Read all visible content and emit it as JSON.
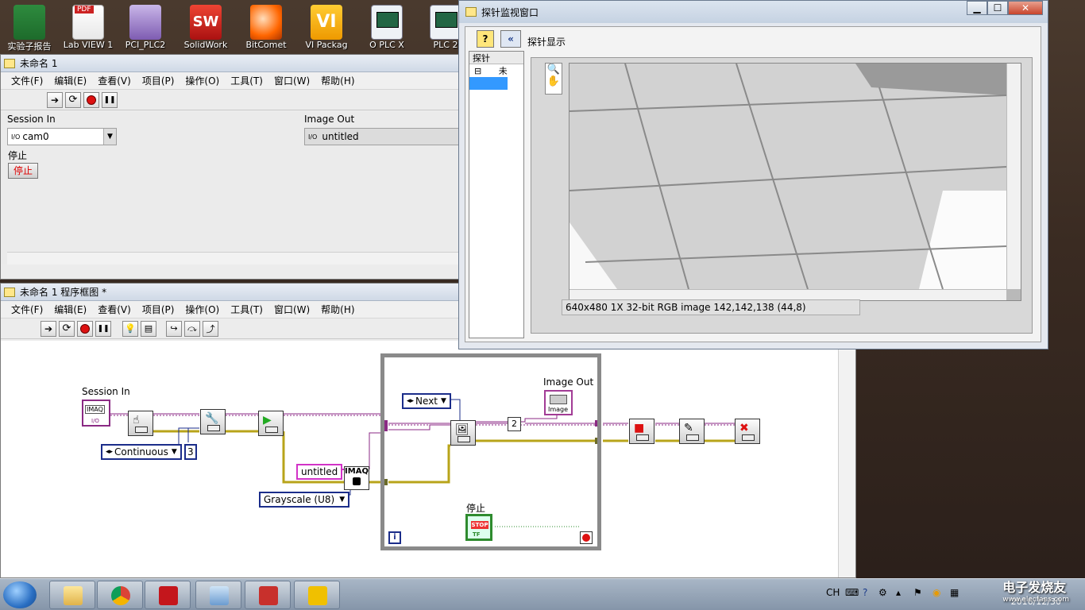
{
  "desktop_icons": [
    {
      "label": "实验子报告",
      "kind": "excel"
    },
    {
      "label": "Lab VIEW 1",
      "kind": "pdf"
    },
    {
      "label": "PCI_PLC2",
      "kind": "vs"
    },
    {
      "label": "SolidWork",
      "kind": "sw"
    },
    {
      "label": "BitComet",
      "kind": "ball"
    },
    {
      "label": "VI Packag",
      "kind": "vi"
    },
    {
      "label": "O PLC X",
      "kind": "scope"
    },
    {
      "label": "PLC 2",
      "kind": "scope"
    }
  ],
  "front_panel": {
    "title": "未命名 1",
    "menu": [
      "文件(F)",
      "编辑(E)",
      "查看(V)",
      "项目(P)",
      "操作(O)",
      "工具(T)",
      "窗口(W)",
      "帮助(H)"
    ],
    "session_in_label": "Session In",
    "session_in_prefix": "I/O",
    "session_in_value": "cam0",
    "image_out_label": "Image Out",
    "image_out_prefix": "I/O",
    "image_out_value": "untitled",
    "stop_label": "停止",
    "stop_button_text": "停止"
  },
  "block_diagram": {
    "title": "未命名 1 程序框图 *",
    "menu": [
      "文件(F)",
      "编辑(E)",
      "查看(V)",
      "项目(P)",
      "操作(O)",
      "工具(T)",
      "窗口(W)",
      "帮助(H)"
    ],
    "session_in_label": "Session In",
    "session_ctl_text": "IMAQ",
    "session_ctl_io": "I/O",
    "continuous": "Continuous",
    "buffers": "3",
    "untitled_const": "untitled",
    "imaq_node": "IMAQ",
    "grayscale": "Grayscale (U8)",
    "next_const": "Next",
    "buffer_num": "2",
    "image_out_label": "Image Out",
    "image_ind_text": "Image",
    "stop_label": "停止",
    "stop_text": "STOP",
    "stop_tf": "TF",
    "iter": "i"
  },
  "probe": {
    "title": "探针监视窗口",
    "display_label": "探针显示",
    "tree_header": "探针",
    "tree_row": "未",
    "tree_expander": "⊟",
    "status": "640x480 1X 32-bit RGB image 142,142,138     (44,8)"
  },
  "taskbar": {
    "lang": "CH",
    "date": "2016/12/30",
    "watermark": "电子发烧友",
    "watermark_url": "www.elecfans.com"
  }
}
